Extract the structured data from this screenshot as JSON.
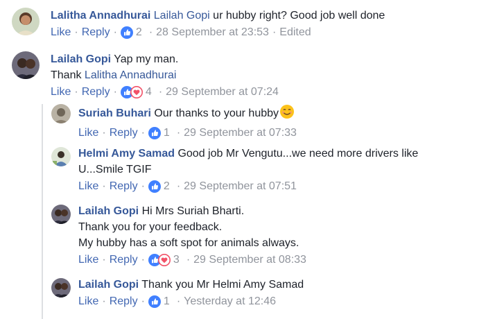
{
  "comments": [
    {
      "author": "Lalitha Annadhurai",
      "mention": "Lailah Gopi",
      "text": " ur hubby right? Good job well done",
      "like": "Like",
      "reply": "Reply",
      "count": "2",
      "time": "28 September at 23:53",
      "edited": "Edited",
      "reactions": [
        "like"
      ]
    },
    {
      "author": "Lailah Gopi",
      "text": " Yap my man.",
      "text2": "Thank ",
      "mention2": "Lalitha Annadhurai",
      "like": "Like",
      "reply": "Reply",
      "count": "4",
      "time": "29 September at 07:24",
      "reactions": [
        "like",
        "love"
      ]
    },
    {
      "author": "Suriah Buhari",
      "text": " Our thanks to your hubby",
      "emoji": "smiling-face",
      "like": "Like",
      "reply": "Reply",
      "count": "1",
      "time": "29 September at 07:33",
      "reactions": [
        "like"
      ]
    },
    {
      "author": "Helmi Amy Samad",
      "text": " Good job Mr Vengutu...we need more drivers like",
      "text2": "U...Smile TGIF",
      "like": "Like",
      "reply": "Reply",
      "count": "2",
      "time": "29 September at 07:51",
      "reactions": [
        "like"
      ]
    },
    {
      "author": "Lailah Gopi",
      "text": " Hi Mrs Suriah Bharti.",
      "text2": "Thank you for your feedback.",
      "text3": "My hubby has a soft spot for animals always.",
      "like": "Like",
      "reply": "Reply",
      "count": "3",
      "time": "29 September at 08:33",
      "reactions": [
        "like",
        "love"
      ]
    },
    {
      "author": "Lailah Gopi",
      "text": " Thank you Mr Helmi Amy Samad",
      "like": "Like",
      "reply": "Reply",
      "count": "1",
      "time": "Yesterday at 12:46",
      "reactions": [
        "like"
      ]
    }
  ],
  "separator": "·",
  "colors": {
    "link": "#365899",
    "meta": "#90949c",
    "like": "#4080ff",
    "love": "#f25268"
  }
}
